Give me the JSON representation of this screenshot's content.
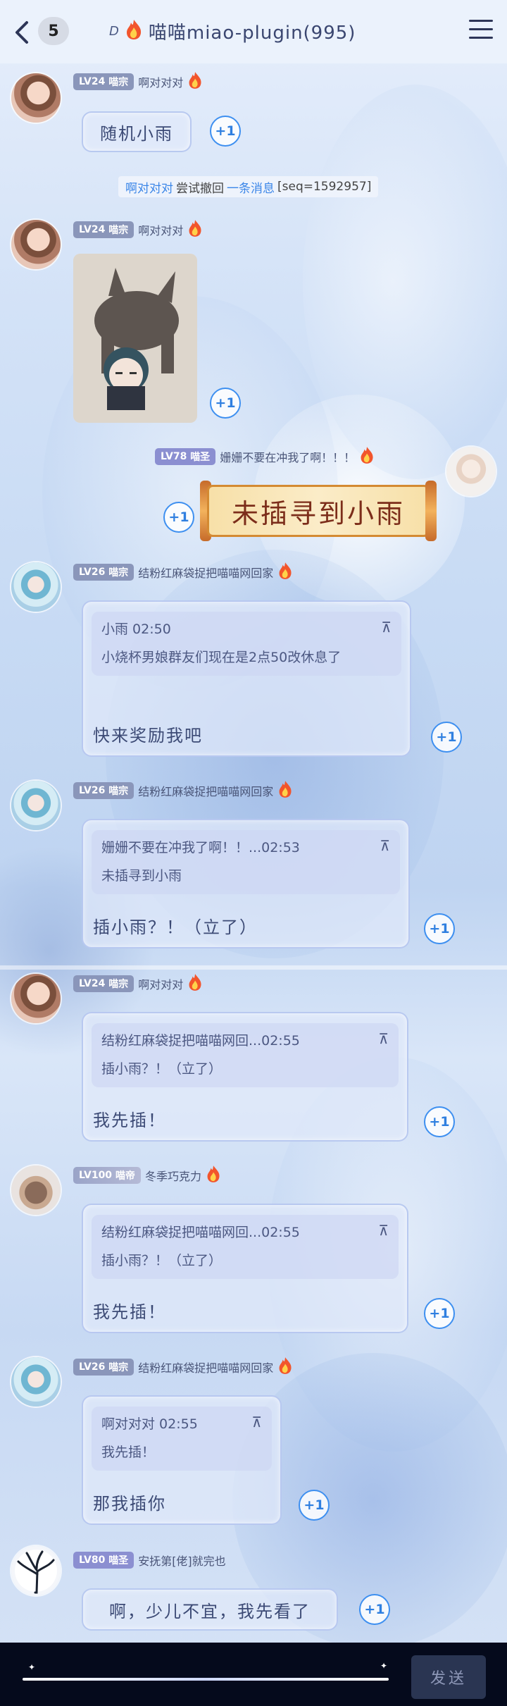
{
  "header": {
    "unread_count": "5",
    "title_prefix": "D",
    "title": "喵喵miao-plugin(995)"
  },
  "recall_notice": {
    "user": "啊对对对",
    "text_mid": "尝试撤回",
    "link": "一条消息",
    "seq": "[seq=1592957]"
  },
  "messages": [
    {
      "level": "LV24",
      "title": "喵宗",
      "nick": "啊对对对",
      "text": "随机小雨",
      "plus": "+1"
    },
    {
      "level": "LV24",
      "title": "喵宗",
      "nick": "啊对对对",
      "plus": "+1"
    },
    {
      "level": "LV78",
      "title": "喵圣",
      "nick": "姗姗不要在冲我了啊！！！",
      "sticker_text": "未插寻到小雨",
      "plus": "+1"
    },
    {
      "level": "LV26",
      "title": "喵宗",
      "nick": "结粉红麻袋捉把喵喵网回家",
      "quote_head": "小雨 02:50",
      "quote_body": "小烧杯男娘群友们现在是2点50改休息了",
      "text": "快来奖励我吧",
      "plus": "+1"
    },
    {
      "level": "LV26",
      "title": "喵宗",
      "nick": "结粉红麻袋捉把喵喵网回家",
      "quote_head": "姗姗不要在冲我了啊！！...02:53",
      "quote_body": "未插寻到小雨",
      "text": "插小雨？！（立了）",
      "plus": "+1"
    },
    {
      "level": "LV24",
      "title": "喵宗",
      "nick": "啊对对对",
      "quote_head": "结粉红麻袋捉把喵喵网回...02:55",
      "quote_body": "插小雨？！（立了）",
      "text": "我先插！",
      "plus": "+1"
    },
    {
      "level": "LV100",
      "title": "喵帝",
      "nick": "冬季巧克力",
      "quote_head": "结粉红麻袋捉把喵喵网回...02:55",
      "quote_body": "插小雨？！（立了）",
      "text": "我先插！",
      "plus": "+1"
    },
    {
      "level": "LV26",
      "title": "喵宗",
      "nick": "结粉红麻袋捉把喵喵网回家",
      "quote_head": "啊对对对 02:55",
      "quote_body": "我先插！",
      "text": "那我插你",
      "plus": "+1"
    },
    {
      "level": "LV80",
      "title": "喵圣",
      "nick": "安抚第[佬]就完也",
      "text": "啊，少儿不宜，我先看了",
      "plus": "+1"
    }
  ],
  "pin_symbol": "⊼",
  "composer": {
    "send_label": "发送"
  }
}
